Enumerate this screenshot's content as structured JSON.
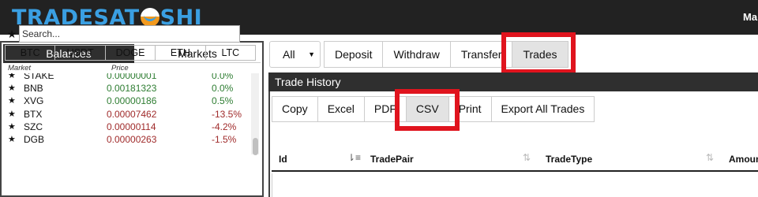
{
  "app": {
    "logo_text_left": "TRADESAT",
    "logo_text_right": "SHI",
    "user_label": "Ma",
    "brand_color": "#3a9fe2",
    "accent_color": "#f39a1e",
    "highlight_color": "#e0141e"
  },
  "left_panel": {
    "tabs": [
      "Balances",
      "Markets"
    ],
    "active_tab": "Markets",
    "favorites_icon": "star-icon",
    "search_placeholder": "Search...",
    "base_tabs": [
      "BTC",
      "USDT",
      "DOGE",
      "ETH",
      "LTC"
    ],
    "columns": {
      "market": "Market",
      "price": "Price"
    },
    "markets": [
      {
        "symbol": "STAKE",
        "price": "0.00000001",
        "change": "0.0%",
        "trend": "zero"
      },
      {
        "symbol": "BNB",
        "price": "0.00181323",
        "change": "0.0%",
        "trend": "zero"
      },
      {
        "symbol": "XVG",
        "price": "0.00000186",
        "change": "0.5%",
        "trend": "pos"
      },
      {
        "symbol": "BTX",
        "price": "0.00007462",
        "change": "-13.5%",
        "trend": "neg"
      },
      {
        "symbol": "SZC",
        "price": "0.00000114",
        "change": "-4.2%",
        "trend": "neg"
      },
      {
        "symbol": "DGB",
        "price": "0.00000263",
        "change": "-1.5%",
        "trend": "neg"
      }
    ]
  },
  "toolbar": {
    "filter_value": "All",
    "nav_buttons": [
      "Deposit",
      "Withdraw",
      "Transfer",
      "Trades"
    ],
    "active_nav": "Trades"
  },
  "trade_history": {
    "title": "Trade History",
    "export_buttons": [
      "Copy",
      "Excel",
      "PDF",
      "CSV",
      "Print",
      "Export All Trades"
    ],
    "active_export": "CSV",
    "columns": [
      "Id",
      "TradePair",
      "TradeType",
      "Amoun"
    ]
  }
}
